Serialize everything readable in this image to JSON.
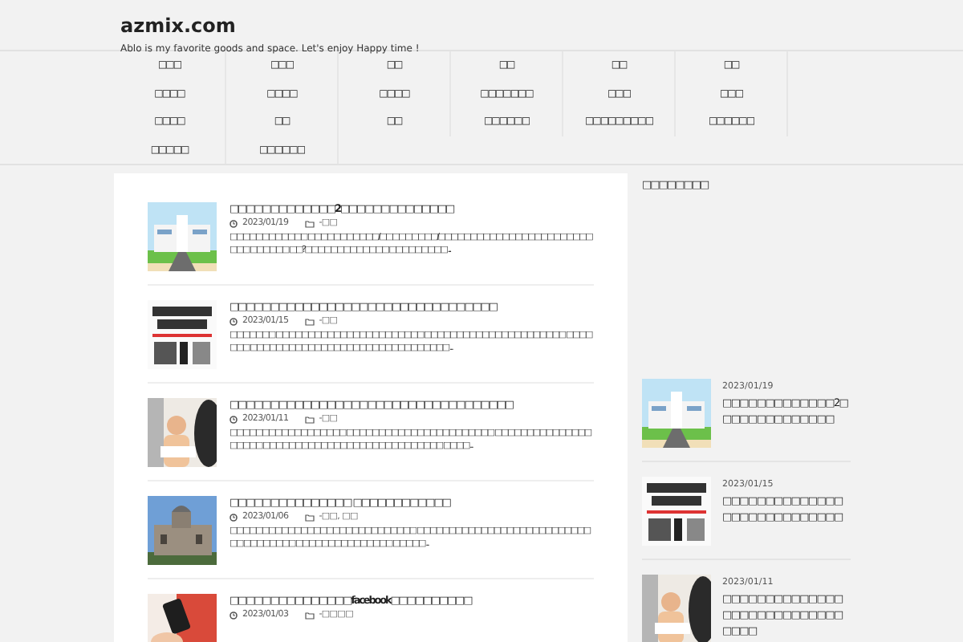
{
  "site": {
    "title": "azmix.com",
    "tagline": "Ablo is my favorite goods and space. Let's enjoy Happy time !"
  },
  "nav": [
    "□□□",
    "□□□",
    "□□",
    "□□",
    "□□",
    "□□",
    "□□□□",
    "□□□□",
    "□□□□",
    "□□□□□□□",
    "□□□",
    "□□□",
    "□□□□",
    "□□",
    "□□",
    "□□□□□□",
    "□□□□□□□□□",
    "□□□□□□",
    "□□□□□",
    "□□□□□□"
  ],
  "posts": [
    {
      "title": "□□□□□□□□□□□□□2□□□□□□□□□□□□□□",
      "date": "2023/01/19",
      "category": "-□□",
      "excerpt": "□□□□□□□□□□□□ □□□□□□□□□□□/□□□□□□□□□/□□□□□□□□□□□□□□□□□□□□□□□□□□□ □□□□□□ □□?□□□□□□□□□□□□□ □□□□□□□□□ ..."
    },
    {
      "title": "□□□□□□□□□□□□□□□□□□□□□□□□□□□□□□□□□",
      "date": "2023/01/15",
      "category": "-□□",
      "excerpt": "□□□□□□□ □□□□□□□□□□□□□□□□□□□□□□□ □□□□□□□□□□□□□□□□□□□□□□ □□□□□□□ □□□□□□□□□□□□□□□□□□□□□□□□□□□□□□□ ..."
    },
    {
      "title": "□□□□□□□□□□□□□□□□□□□□□□□□□□□□□□□□□□□",
      "date": "2023/01/11",
      "category": "-□□",
      "excerpt": "□□□□□□□□□□□□□□□□□□ □□□□□□□□□□□□□□□□□□□□□□□ □□□□□□□□□□□□□□□□□□□□ □□□□□□□□□□□□□□□□□□□□□□□□□□□□ □□□□ ..."
    },
    {
      "title": "□□□□□□□□□□□□□□□ □□□□□□□□□□□□",
      "date": "2023/01/06",
      "category": "-□□, □□",
      "excerpt": "□□□□□□□□□□□□□□□□□□□□□□□□□□□□□ □□□□□□□□□□□□□□□□□□□□□□□□□□□□□ □□□□□□□□ □□□□□□□□□□□□□□□ □□□□□ ..."
    },
    {
      "title": "□□□□□□□□□□□□□□□facebook□□□□□□□□□□",
      "date": "2023/01/03",
      "category": "-□□□□"
    }
  ],
  "sidebar": {
    "heading": "□□□□□□□□",
    "items": [
      {
        "date": "2023/01/19",
        "title": "□□□□□□□□□□□□□2□□□□□□□□□□□□□□"
      },
      {
        "date": "2023/01/15",
        "title": "□□□□□□□□□□□□□□□□□□□□□□□□□□□□"
      },
      {
        "date": "2023/01/11",
        "title": "□□□□□□□□□□□□□□□□□□□□□□□□□□□□□□□□"
      }
    ]
  }
}
